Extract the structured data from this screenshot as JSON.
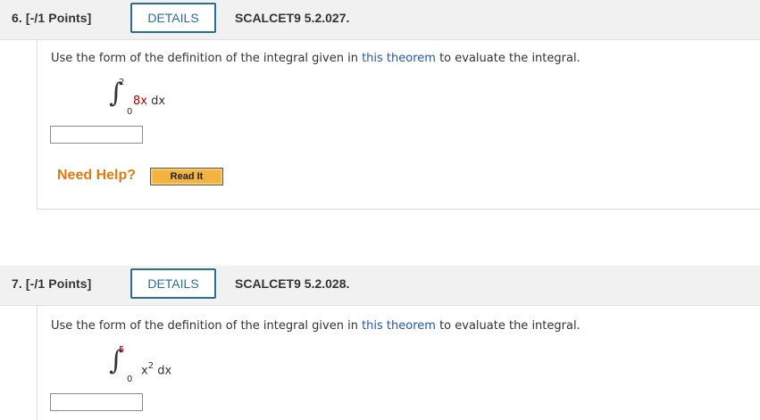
{
  "questions": [
    {
      "number_label": "6.",
      "points_label": "[-/1 Points]",
      "details_label": "DETAILS",
      "reference": "SCALCET9 5.2.027.",
      "prompt_before": "Use the form of the definition of the integral given in ",
      "link_text": "this theorem",
      "prompt_after": " to evaluate the integral.",
      "integral": {
        "upper": "2",
        "lower": "0",
        "integrand_coef": "8x",
        "integrand_rest": " dx"
      },
      "answer_value": "",
      "need_help_label": "Need Help?",
      "read_it_label": "Read It"
    },
    {
      "number_label": "7.",
      "points_label": "[-/1 Points]",
      "details_label": "DETAILS",
      "reference": "SCALCET9 5.2.028.",
      "prompt_before": "Use the form of the definition of the integral given in ",
      "link_text": "this theorem",
      "prompt_after": " to evaluate the integral.",
      "integral": {
        "upper": "5",
        "lower": "0",
        "integrand_base": "x",
        "integrand_exp": "2",
        "integrand_rest": " dx"
      },
      "answer_value": ""
    }
  ],
  "colors": {
    "accent": "#2a6e93",
    "link": "#2255b9",
    "highlight": "#c00000",
    "help": "#e07a10",
    "button": "#f4b33f"
  }
}
